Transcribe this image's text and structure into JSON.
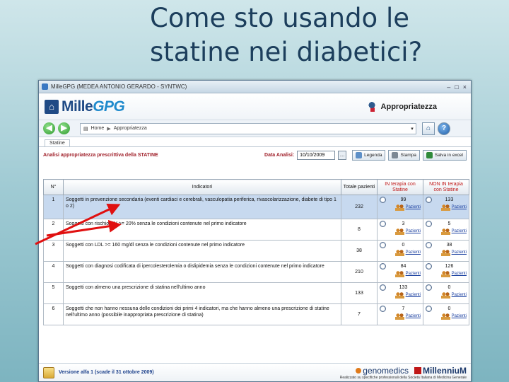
{
  "slide": {
    "title_line1": "Come sto usando le",
    "title_line2": "statine nei diabetici?"
  },
  "window": {
    "title": "MilleGPG (MEDEA ANTONIO GERARDO - SYNTWC)",
    "controls": [
      "–",
      "□",
      "×"
    ]
  },
  "app": {
    "logo_part1": "Mille",
    "logo_part2": "GPG",
    "section_title": "Appropriatezza"
  },
  "nav": {
    "back": "◀",
    "forward": "▶",
    "breadcrumb_home": "Home",
    "breadcrumb_separator": "▶",
    "breadcrumb_current": "Appropriatezza",
    "help": "?"
  },
  "tabs": [
    "Statine"
  ],
  "toolbar": {
    "analysis_title": "Analisi appropriatezza prescrittiva della STATINE",
    "date_label": "Data Analisi:",
    "date_value": "10/10/2009",
    "date_button": "…",
    "legend_button": "Legenda",
    "print_button": "Stampa",
    "excel_button": "Salva in excel"
  },
  "table": {
    "headers": {
      "n": "N°",
      "indicators": "Indicatori",
      "total": "Totale pazienti",
      "in_therapy": "IN terapia con Statine",
      "not_in_therapy": "NON IN terapia con Statine"
    },
    "link_label": "Pazienti",
    "rows": [
      {
        "n": "1",
        "text": "Soggetti in prevenzione secondaria (eventi cardiaci e cerebrali, vasculopatia periferica, rivascolarizzazione, diabete di tipo 1 o 2)",
        "total": "232",
        "in": "99",
        "not_in": "133"
      },
      {
        "n": "2",
        "text": "Soggetti con rischio CV >= 20% senza le condizioni contenute nel primo indicatore",
        "total": "8",
        "in": "3",
        "not_in": "5"
      },
      {
        "n": "3",
        "text": "Soggetti con LDL >= 160 mg/dl senza le condizioni contenute nel primo indicatore",
        "total": "38",
        "in": "0",
        "not_in": "38"
      },
      {
        "n": "4",
        "text": "Soggetti con diagnosi codificata di ipercolesterolemia o dislipidemia senza le condizioni contenute nel primo indicatore",
        "total": "210",
        "in": "84",
        "not_in": "126"
      },
      {
        "n": "5",
        "text": "Soggetti con almeno una prescrizione di statina nell'ultimo anno",
        "total": "133",
        "in": "133",
        "not_in": "0"
      },
      {
        "n": "6",
        "text": "Soggetti che non hanno nessuna delle condizioni dei primi 4 indicatori, ma che hanno almeno una prescrizione di statine nell'ultimo anno (possibile inappropriata prescrizione di statina)",
        "total": "7",
        "in": "7",
        "not_in": "0"
      }
    ]
  },
  "footer": {
    "version": "Versione alfa 1 (scade il 31 ottobre 2009)",
    "logo_genomedics": "genomedics",
    "logo_millennium": "MillenniuM",
    "note": "Realizzato su specifiche professionali della Società Italiana di Medicina Generale"
  },
  "colors": {
    "accent_red": "#c01818",
    "selected_row": "#c7d9ef",
    "arrow_red": "#e01010"
  }
}
